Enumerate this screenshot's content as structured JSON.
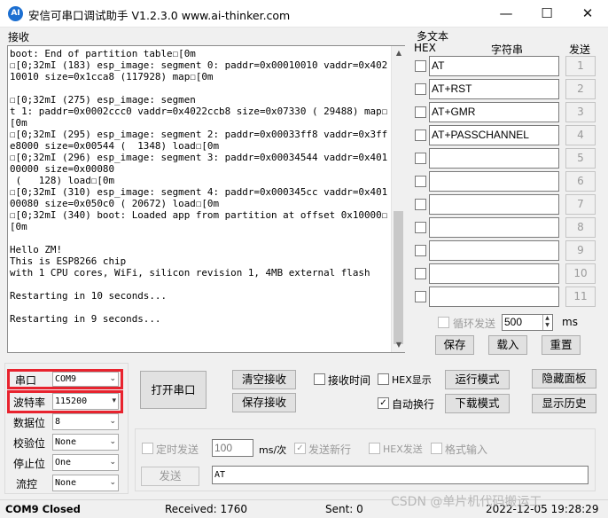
{
  "window": {
    "title": "安信可串口调试助手 V1.2.3.0     www.ai-thinker.com",
    "icon_text": "AI",
    "min_symbol": "—",
    "max_symbol": "☐",
    "close_symbol": "✕"
  },
  "receive": {
    "label": "接收",
    "text": "boot: End of partition table☐[0m\n☐[0;32mI (183) esp_image: segment 0: paddr=0x00010010 vaddr=0x40210010 size=0x1cca8 (117928) map☐[0m\n\n☐[0;32mI (275) esp_image: segmen\nt 1: paddr=0x0002ccc0 vaddr=0x4022ccb8 size=0x07330 ( 29488) map☐[0m\n☐[0;32mI (295) esp_image: segment 2: paddr=0x00033ff8 vaddr=0x3ffe8000 size=0x00544 (  1348) load☐[0m\n☐[0;32mI (296) esp_image: segment 3: paddr=0x00034544 vaddr=0x40100000 size=0x00080\n (   128) load☐[0m\n☐[0;32mI (310) esp_image: segment 4: paddr=0x000345cc vaddr=0x40100080 size=0x050c0 ( 20672) load☐[0m\n☐[0;32mI (340) boot: Loaded app from partition at offset 0x10000☐[0m\n\nHello ZM!\nThis is ESP8266 chip\nwith 1 CPU cores, WiFi, silicon revision 1, 4MB external flash\n\nRestarting in 10 seconds...\n\nRestarting in 9 seconds..."
  },
  "multitext": {
    "label": "多文本",
    "hex_header": "HEX",
    "string_header": "字符串",
    "send_header": "发送",
    "rows": [
      {
        "text": "AT",
        "num": "1"
      },
      {
        "text": "AT+RST",
        "num": "2"
      },
      {
        "text": "AT+GMR",
        "num": "3"
      },
      {
        "text": "AT+PASSCHANNEL",
        "num": "4"
      },
      {
        "text": "",
        "num": "5"
      },
      {
        "text": "",
        "num": "6"
      },
      {
        "text": "",
        "num": "7"
      },
      {
        "text": "",
        "num": "8"
      },
      {
        "text": "",
        "num": "9"
      },
      {
        "text": "",
        "num": "10"
      },
      {
        "text": "",
        "num": "11"
      }
    ],
    "loop_send_label": "循环发送",
    "interval_value": "500",
    "interval_unit": "ms",
    "save_button": "保存",
    "load_button": "载入",
    "reset_button": "重置"
  },
  "settings": {
    "port_label": "串口",
    "port_value": "COM9",
    "baud_label": "波特率",
    "baud_value": "115200",
    "databits_label": "数据位",
    "databits_value": "8",
    "parity_label": "校验位",
    "parity_value": "None",
    "stopbits_label": "停止位",
    "stopbits_value": "One",
    "flow_label": "流控",
    "flow_value": "None"
  },
  "controls": {
    "open_port": "打开串口",
    "clear_receive": "清空接收",
    "save_receive": "保存接收",
    "receive_time": "接收时间",
    "hex_display": "HEX显示",
    "auto_newline": "自动换行",
    "run_mode": "运行模式",
    "download_mode": "下载模式",
    "hide_panel": "隐藏面板",
    "show_history": "显示历史",
    "timed_send": "定时发送",
    "timed_value": "100",
    "timed_unit": "ms/次",
    "send_newline": "发送新行",
    "hex_send": "HEX发送",
    "format_input": "格式输入",
    "send_button": "发送",
    "send_input": "AT"
  },
  "status": {
    "port_state": "COM9 Closed",
    "received": "Received: 1760",
    "sent": "Sent: 0",
    "datetime": "2022-12-05 19:28:29",
    "watermark": "CSDN @单片机代码搬运工"
  },
  "colors": {
    "highlight_border": "#e8232e",
    "window_bg": "#f0f0f0"
  }
}
